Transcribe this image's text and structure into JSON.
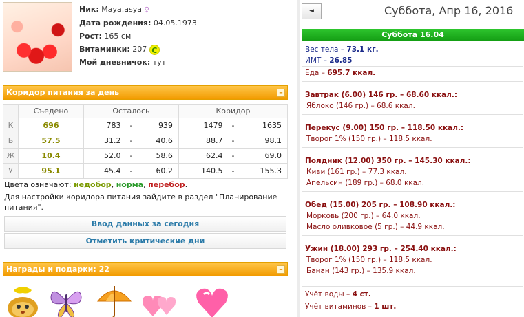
{
  "profile": {
    "nick_label": "Ник:",
    "nick_value": "Maya.asya",
    "birth_label": "Дата рождения:",
    "birth_value": "04.05.1973",
    "height_label": "Рост:",
    "height_value": "165 см",
    "vit_label": "Витаминки:",
    "vit_value": "207",
    "vit_badge": "C",
    "diary_label": "Мой дневничок:",
    "diary_value": "тут"
  },
  "corridor": {
    "header": "Коридор питания за день",
    "columns": [
      "Съедено",
      "Осталось",
      "Коридор"
    ],
    "rows": [
      {
        "label": "К",
        "eaten": "696",
        "left_min": "783",
        "left_max": "939",
        "corr_min": "1479",
        "corr_max": "1635"
      },
      {
        "label": "Б",
        "eaten": "57.5",
        "left_min": "31.2",
        "left_max": "40.6",
        "corr_min": "88.7",
        "corr_max": "98.1"
      },
      {
        "label": "Ж",
        "eaten": "10.4",
        "left_min": "52.0",
        "left_max": "58.6",
        "corr_min": "62.4",
        "corr_max": "69.0"
      },
      {
        "label": "У",
        "eaten": "95.1",
        "left_min": "45.4",
        "left_max": "60.2",
        "corr_min": "140.5",
        "corr_max": "155.3"
      }
    ],
    "dash": "-",
    "colors_prefix": "Цвета означают:",
    "color_under": "недобор",
    "color_norm": "норма",
    "color_over": "перебор",
    "settings_text": "Для настройки коридора питания зайдите в раздел \"Планирование питания\".",
    "btn_enter": "Ввод данных за сегодня",
    "btn_critical": "Отметить критические дни"
  },
  "awards": {
    "header": "Награды и подарки:",
    "count": "22"
  },
  "diary": {
    "prev_symbol": "◄",
    "date_title": "Суббота, Апр 16, 2016",
    "day_bar": "Суббота 16.04",
    "weight": "Вес тела – ",
    "weight_val": "73.1 кг.",
    "bmi": "ИМТ – ",
    "bmi_val": "26.85",
    "food_total": "Еда – ",
    "food_total_val": "695.7 ккал.",
    "meals": [
      {
        "title": "Завтрак (6.00) 146 гр. – 68.60 ккал.:",
        "items": [
          "Яблоко (146 гр.) – 68.6 ккал."
        ]
      },
      {
        "title": "Перекус (9.00) 150 гр. – 118.50 ккал.:",
        "items": [
          "Творог 1% (150 гр.) – 118.5 ккал."
        ]
      },
      {
        "title": "Полдник (12.00) 350 гр. – 145.30 ккал.:",
        "items": [
          "Киви (161 гр.) – 77.3 ккал.",
          "Апельсин (189 гр.) – 68.0 ккал."
        ]
      },
      {
        "title": "Обед (15.00) 205 гр. – 108.90 ккал.:",
        "items": [
          "Морковь (200 гр.) – 64.0 ккал.",
          "Масло оливковое (5 гр.) – 44.9 ккал."
        ]
      },
      {
        "title": "Ужин (18.00) 293 гр. – 254.40 ккал.:",
        "items": [
          "Творог 1% (150 гр.) – 118.5 ккал.",
          "Банан (143 гр.) – 135.9 ккал."
        ]
      }
    ],
    "water": "Учёт воды – ",
    "water_val": "4 ст.",
    "vitamins": "Учёт витаминов – ",
    "vitamins_val": "1 шт."
  }
}
